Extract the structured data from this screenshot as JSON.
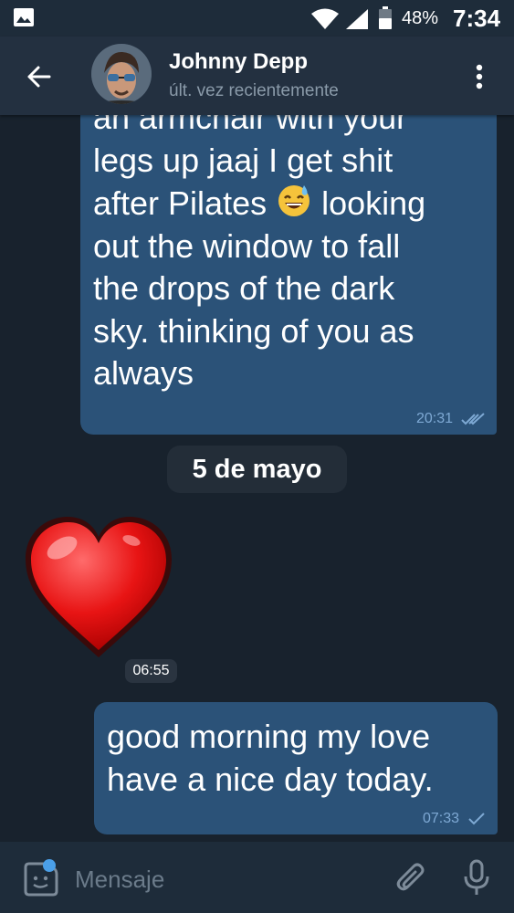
{
  "status_bar": {
    "battery_percent": "48%",
    "time": "7:34"
  },
  "header": {
    "contact_name": "Johnny Depp",
    "contact_status": "últ. vez recientemente"
  },
  "messages": [
    {
      "direction": "outgoing",
      "text_lines": [
        "an armchair with your",
        "legs up jaaj I get shit",
        "after Pilates",
        "looking",
        "out the window to fall",
        "the drops of the dark",
        "sky. thinking of you as",
        "always"
      ],
      "time": "20:31",
      "read": true
    },
    {
      "direction": "incoming",
      "sticker": "red-heart",
      "time": "06:55"
    },
    {
      "direction": "outgoing",
      "text": "good morning my love have a nice day today.",
      "time": "07:33",
      "read": false
    }
  ],
  "date_separator": "5 de mayo",
  "composer": {
    "placeholder": "Mensaje"
  },
  "colors": {
    "background": "#18222d",
    "header": "#233040",
    "outgoing_bubble": "#2b5278",
    "accent": "#4a9fe8"
  }
}
